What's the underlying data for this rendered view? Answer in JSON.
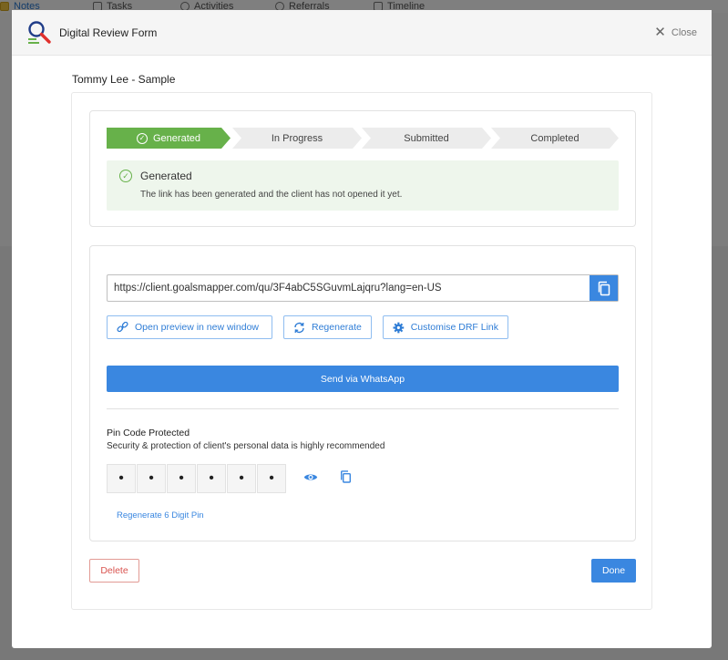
{
  "background": {
    "tabs": [
      {
        "label": "Notes",
        "active": true
      },
      {
        "label": "Tasks",
        "active": false
      },
      {
        "label": "Activities",
        "active": false
      },
      {
        "label": "Referrals",
        "active": false
      },
      {
        "label": "Timeline",
        "active": false
      }
    ]
  },
  "modal": {
    "title": "Digital Review Form",
    "close_label": "Close",
    "client_name": "Tommy Lee - Sample",
    "steps": [
      {
        "label": "Generated",
        "active": true
      },
      {
        "label": "In Progress",
        "active": false
      },
      {
        "label": "Submitted",
        "active": false
      },
      {
        "label": "Completed",
        "active": false
      }
    ],
    "status": {
      "title": "Generated",
      "description": "The link has been generated and the client has not opened it yet."
    },
    "link": {
      "url": "https://client.goalsmapper.com/qu/3F4abC5SGuvmLajqru?lang=en-US",
      "open_preview_label": "Open preview in new window",
      "regenerate_label": "Regenerate",
      "customise_label": "Customise DRF Link",
      "whatsapp_label": "Send via WhatsApp"
    },
    "pin": {
      "title": "Pin Code Protected",
      "description": "Security & protection of client's personal data is highly recommended",
      "digits": [
        "•",
        "•",
        "•",
        "•",
        "•",
        "•"
      ],
      "regenerate_label": "Regenerate 6 Digit Pin"
    },
    "footer": {
      "delete_label": "Delete",
      "done_label": "Done"
    }
  },
  "colors": {
    "primary": "#3a87e0",
    "success": "#67b14a",
    "danger": "#d9534f"
  }
}
